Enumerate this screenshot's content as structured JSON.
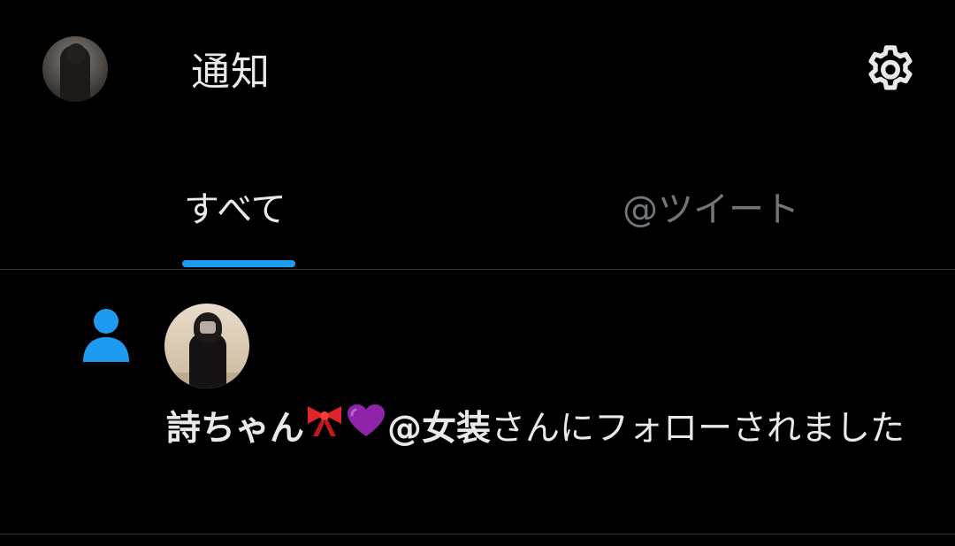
{
  "header": {
    "title": "通知",
    "avatar_icon": "profile-avatar",
    "settings_icon": "gear-icon"
  },
  "tabs": [
    {
      "label": "すべて",
      "active": true
    },
    {
      "label": "@ツイート",
      "active": false
    }
  ],
  "notification": {
    "type_icon": "person-follow-icon",
    "user_name": "詩ちゃん",
    "name_emojis": [
      "ribbon-icon",
      "purple-heart-icon"
    ],
    "user_handle_suffix": "@女装",
    "action_text": "さんにフォローされました"
  },
  "colors": {
    "background": "#000000",
    "accent": "#1d9bf0",
    "text_primary": "#e7e9ea",
    "text_secondary": "#71767b",
    "divider": "#2f3336"
  }
}
